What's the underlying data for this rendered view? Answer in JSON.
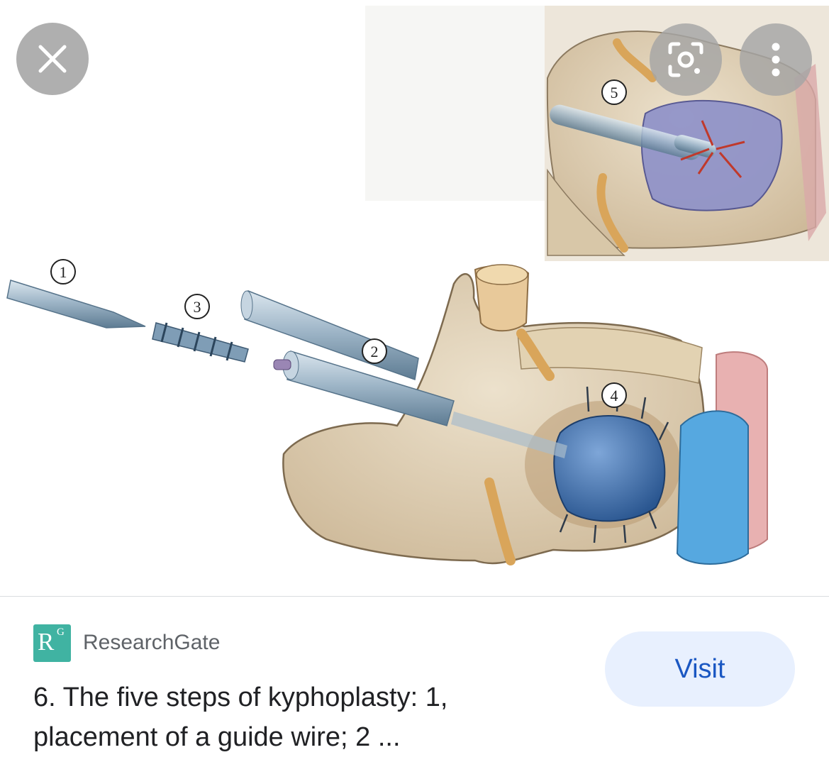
{
  "viewer": {
    "close_icon": "close-icon",
    "lens_icon": "google-lens-icon",
    "more_icon": "more-vert-icon",
    "image_labels": [
      "1",
      "2",
      "3",
      "4",
      "5"
    ]
  },
  "result": {
    "source_logo_letter": "R",
    "source_logo_sup": "G",
    "source_name": "ResearchGate",
    "title": "6. The five steps of kyphoplasty: 1, placement of a guide wire; 2 ...",
    "visit_label": "Visit"
  },
  "colors": {
    "visit_bg": "#e8f0fe",
    "visit_text": "#1a57c2",
    "researchgate_brand": "#40b3a2"
  }
}
